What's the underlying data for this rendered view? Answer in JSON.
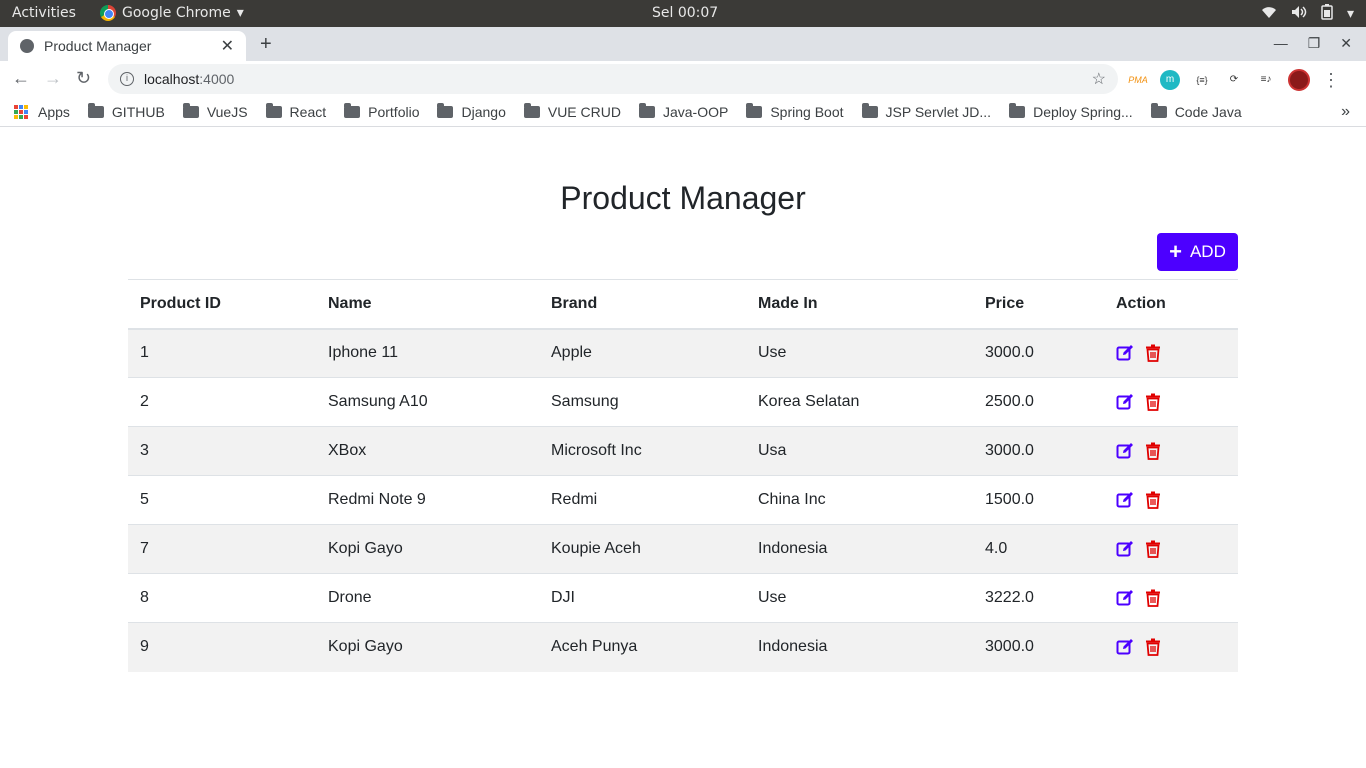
{
  "os_bar": {
    "activities": "Activities",
    "app_name": "Google Chrome",
    "clock": "Sel 00:07"
  },
  "browser": {
    "tab_title": "Product Manager",
    "url_host": "localhost",
    "url_port": ":4000",
    "extensions": [
      "PMA",
      "m",
      "{≡}"
    ],
    "bookmarks": [
      {
        "label": "Apps",
        "icon": "apps-grid-icon"
      },
      {
        "label": "GITHUB",
        "icon": "folder-icon"
      },
      {
        "label": "VueJS",
        "icon": "folder-icon"
      },
      {
        "label": "React",
        "icon": "folder-icon"
      },
      {
        "label": "Portfolio",
        "icon": "folder-icon"
      },
      {
        "label": "Django",
        "icon": "folder-icon"
      },
      {
        "label": "VUE CRUD",
        "icon": "folder-icon"
      },
      {
        "label": "Java-OOP",
        "icon": "folder-icon"
      },
      {
        "label": "Spring Boot",
        "icon": "folder-icon"
      },
      {
        "label": "JSP Servlet JD...",
        "icon": "folder-icon"
      },
      {
        "label": "Deploy Spring...",
        "icon": "folder-icon"
      },
      {
        "label": "Code Java",
        "icon": "folder-icon"
      }
    ]
  },
  "page": {
    "title": "Product Manager",
    "add_label": "ADD",
    "accent_color": "#4c00ff",
    "delete_color": "#e00000",
    "columns": [
      "Product ID",
      "Name",
      "Brand",
      "Made In",
      "Price",
      "Action"
    ],
    "rows": [
      {
        "id": "1",
        "name": "Iphone 11",
        "brand": "Apple",
        "made_in": "Use",
        "price": "3000.0"
      },
      {
        "id": "2",
        "name": "Samsung A10",
        "brand": "Samsung",
        "made_in": "Korea Selatan",
        "price": "2500.0"
      },
      {
        "id": "3",
        "name": "XBox",
        "brand": "Microsoft Inc",
        "made_in": "Usa",
        "price": "3000.0"
      },
      {
        "id": "5",
        "name": "Redmi Note 9",
        "brand": "Redmi",
        "made_in": "China Inc",
        "price": "1500.0"
      },
      {
        "id": "7",
        "name": "Kopi Gayo",
        "brand": "Koupie Aceh",
        "made_in": "Indonesia",
        "price": "4.0"
      },
      {
        "id": "8",
        "name": "Drone",
        "brand": "DJI",
        "made_in": "Use",
        "price": "3222.0"
      },
      {
        "id": "9",
        "name": "Kopi Gayo",
        "brand": "Aceh Punya",
        "made_in": "Indonesia",
        "price": "3000.0"
      }
    ]
  }
}
